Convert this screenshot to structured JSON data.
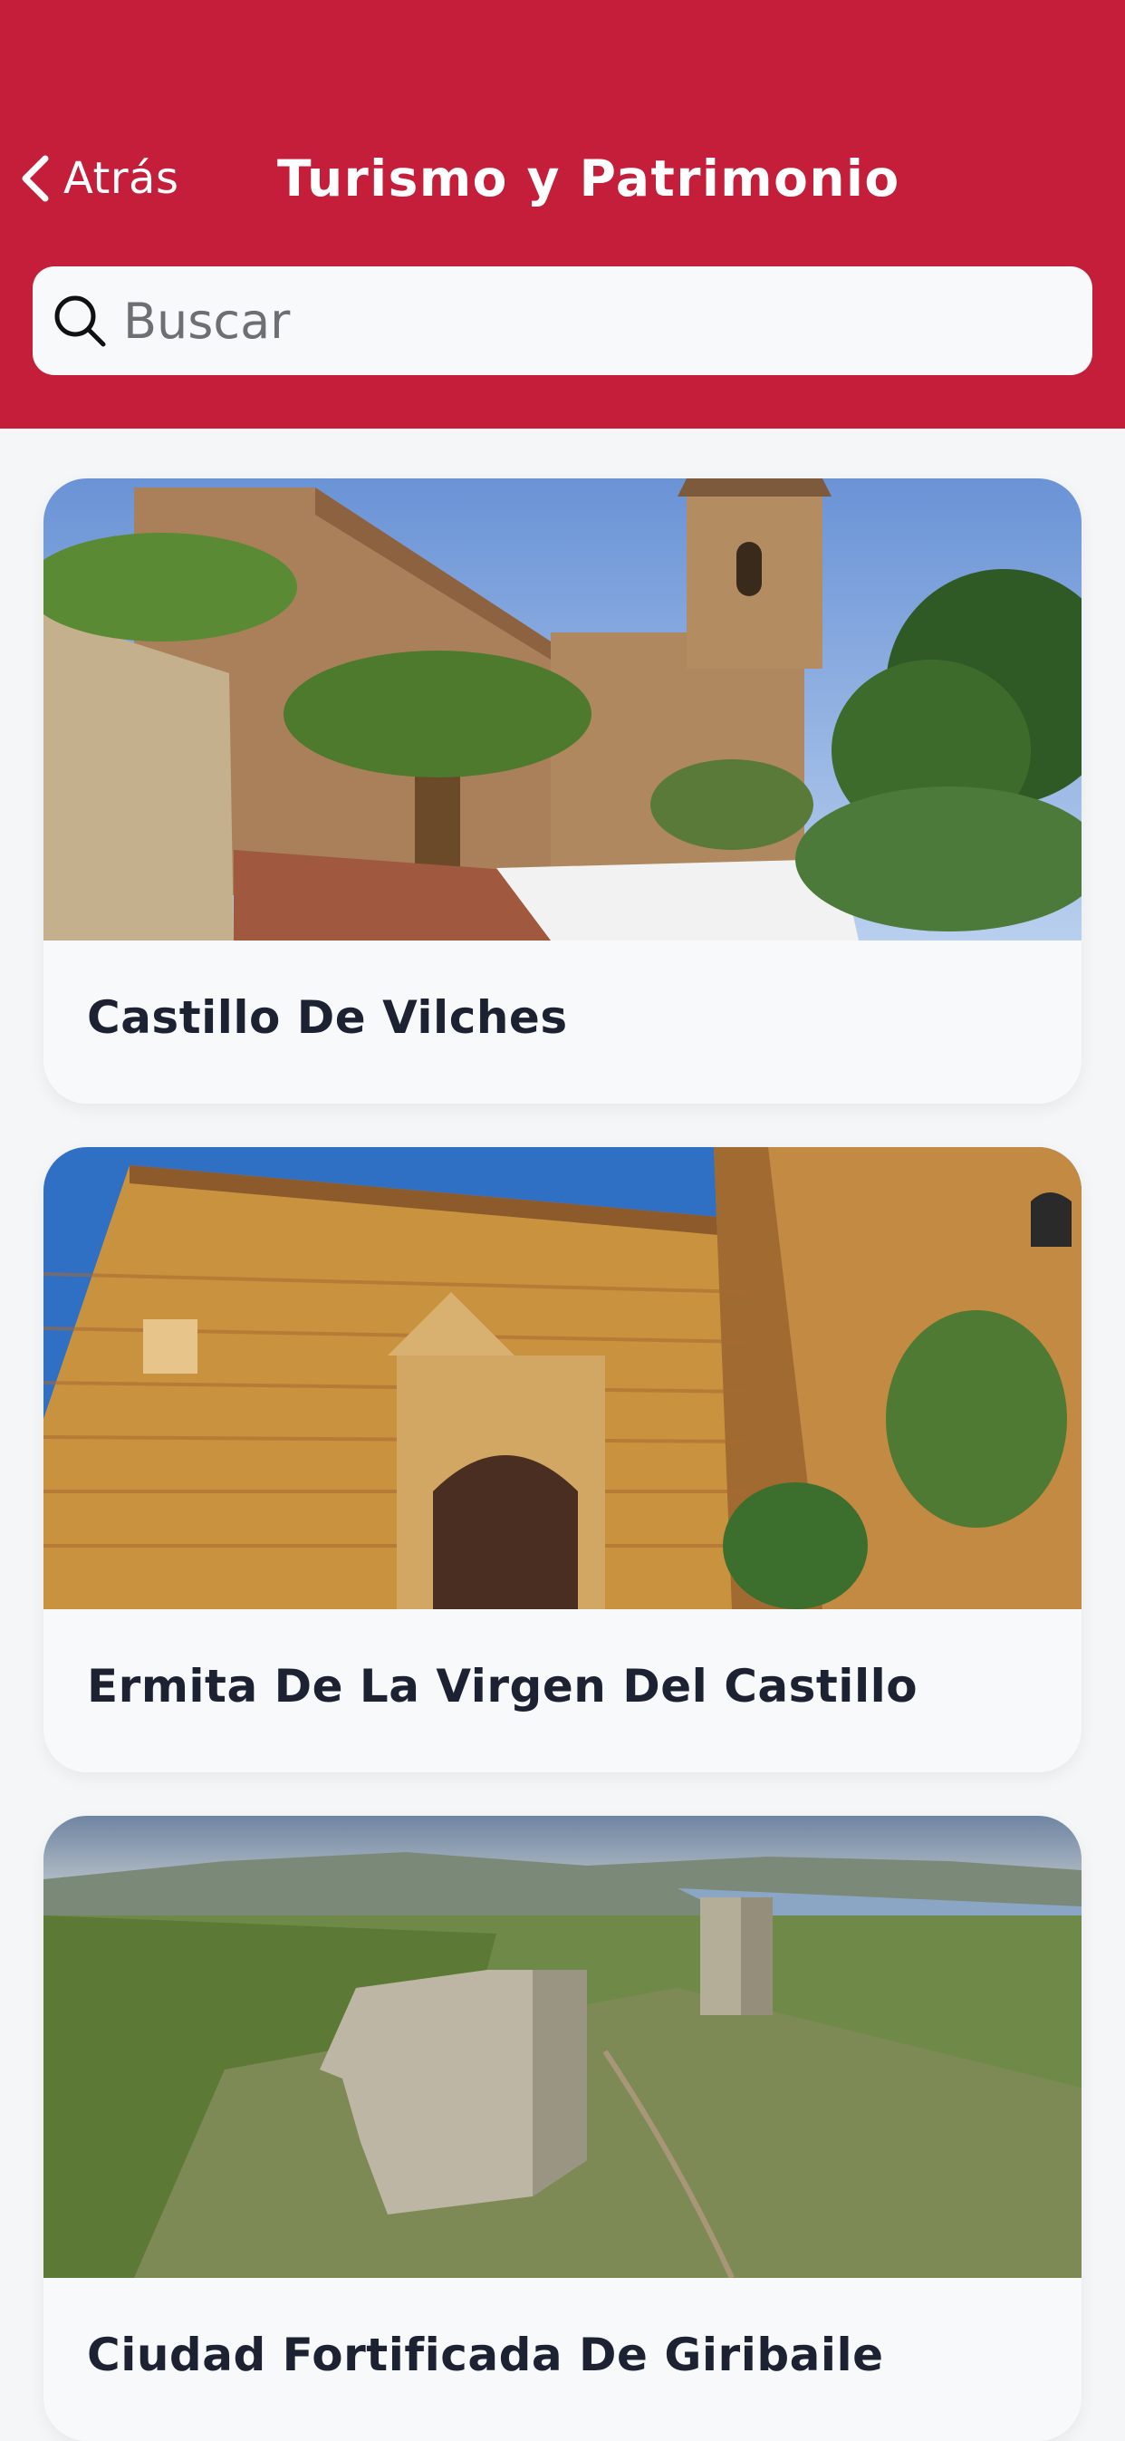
{
  "header": {
    "back_label": "Atrás",
    "title": "Turismo y Patrimonio",
    "back_icon": "chevron-left-icon",
    "background_color": "#c41e3a"
  },
  "search": {
    "placeholder": "Buscar",
    "value": "",
    "icon": "search-icon"
  },
  "places": [
    {
      "title": "Castillo De Vilches"
    },
    {
      "title": "Ermita De La Virgen Del Castillo"
    },
    {
      "title": "Ciudad Fortificada De Giribaile"
    }
  ]
}
